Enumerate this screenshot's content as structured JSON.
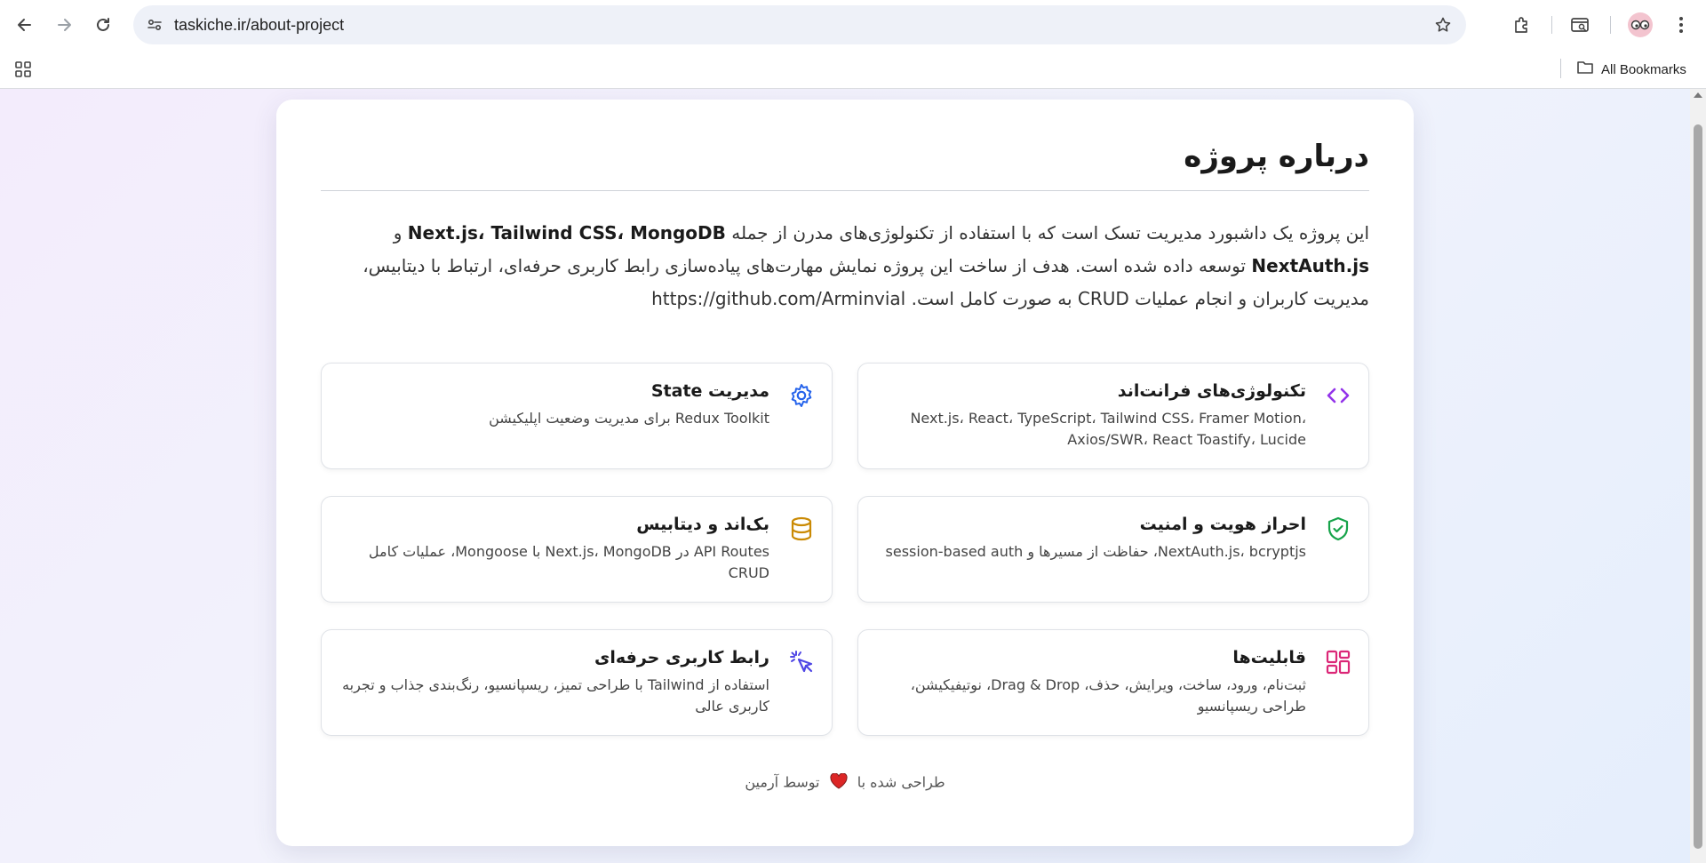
{
  "browser": {
    "url": "taskiche.ir/about-project",
    "bookmarks_label": "All Bookmarks",
    "icons": [
      "back-icon",
      "forward-icon",
      "reload-icon",
      "site-info-icon",
      "star-icon",
      "extensions-icon",
      "tab-search-icon",
      "profile-avatar",
      "menu-icon",
      "apps-icon",
      "folder-icon"
    ]
  },
  "page": {
    "title": "درباره پروژه",
    "intro": {
      "part1": "این پروژه یک داشبورد مدیریت تسک است که با استفاده از تکنولوژی‌های مدرن از جمله ",
      "tech1": "Next.js، Tailwind CSS، MongoDB",
      "and": " و ",
      "tech2": "NextAuth.js",
      "part2": " توسعه داده شده است. هدف از ساخت این پروژه نمایش مهارت‌های پیاده‌سازی رابط کاربری حرفه‌ای، ارتباط با دیتابیس، مدیریت کاربران و انجام عملیات CRUD به صورت کامل است. https://github.com/Arminvial"
    },
    "features": [
      {
        "title": "تکنولوژی‌های فرانت‌اند",
        "desc": "Next.js، React، TypeScript، Tailwind CSS، Framer Motion، Axios/SWR، React Toastify، Lucide",
        "icon": "code-icon",
        "color": "#9333ea"
      },
      {
        "title": "مدیریت State",
        "desc": "Redux Toolkit برای مدیریت وضعیت اپلیکیشن",
        "icon": "gear-icon",
        "color": "#2563eb"
      },
      {
        "title": "احراز هویت و امنیت",
        "desc": "NextAuth.js، bcryptjs، حفاظت از مسیرها و session-based auth",
        "icon": "shield-check-icon",
        "color": "#16a34a"
      },
      {
        "title": "بک‌اند و دیتابیس",
        "desc": "API Routes در Next.js، MongoDB با Mongoose، عملیات کامل CRUD",
        "icon": "database-icon",
        "color": "#ca8a04"
      },
      {
        "title": "قابلیت‌ها",
        "desc": "ثبت‌نام، ورود، ساخت، ویرایش، حذف، Drag & Drop، نوتیفیکیشن، طراحی ریسپانسیو",
        "icon": "layout-grid-icon",
        "color": "#db2777"
      },
      {
        "title": "رابط کاربری حرفه‌ای",
        "desc": "استفاده از Tailwind با طراحی تمیز، ریسپانسیو، رنگ‌بندی جذاب و تجربه کاربری عالی",
        "icon": "pointer-click-icon",
        "color": "#4f46e5"
      }
    ],
    "footer": {
      "before": "طراحی شده با",
      "after": "توسط آرمین",
      "heart_color": "#dc2626"
    }
  }
}
